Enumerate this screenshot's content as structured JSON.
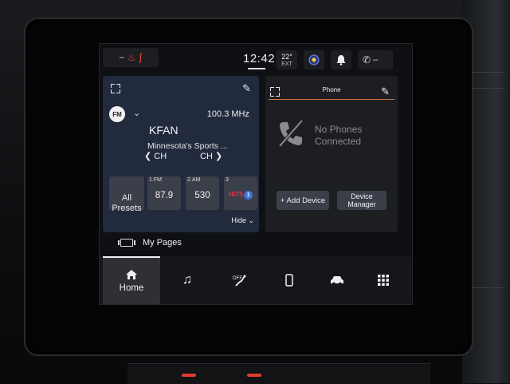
{
  "status_bar": {
    "seat_label": "–",
    "time": "12:42",
    "temperature": "22°",
    "temperature_label": "EXT",
    "phone_status": "–"
  },
  "radio": {
    "band": "FM",
    "frequency": "100.3 MHz",
    "station_name": "KFAN",
    "station_desc": "Minnesota's Sports ...",
    "ch_prev_label": "CH",
    "ch_next_label": "CH",
    "all_presets_label": "All\nPresets",
    "presets": [
      {
        "label": "1.FM",
        "value": "87.9"
      },
      {
        "label": "2.AM",
        "value": "530"
      },
      {
        "label": "3",
        "value": "HITS",
        "logo_num": "1"
      }
    ],
    "hide_label": "Hide"
  },
  "phone": {
    "title": "Phone",
    "no_phones_text": "No Phones\nConnected",
    "add_device_label": "+ Add Device",
    "device_manager_label": "Device\nManager"
  },
  "my_pages_label": "My Pages",
  "nav": {
    "home_label": "Home",
    "items": [
      "home",
      "media",
      "controls",
      "phone",
      "vehicle",
      "apps"
    ]
  },
  "colors": {
    "radio_card": "#222b3e",
    "phone_accent": "#c9754a",
    "seat_heat": "#ff4b3e"
  }
}
